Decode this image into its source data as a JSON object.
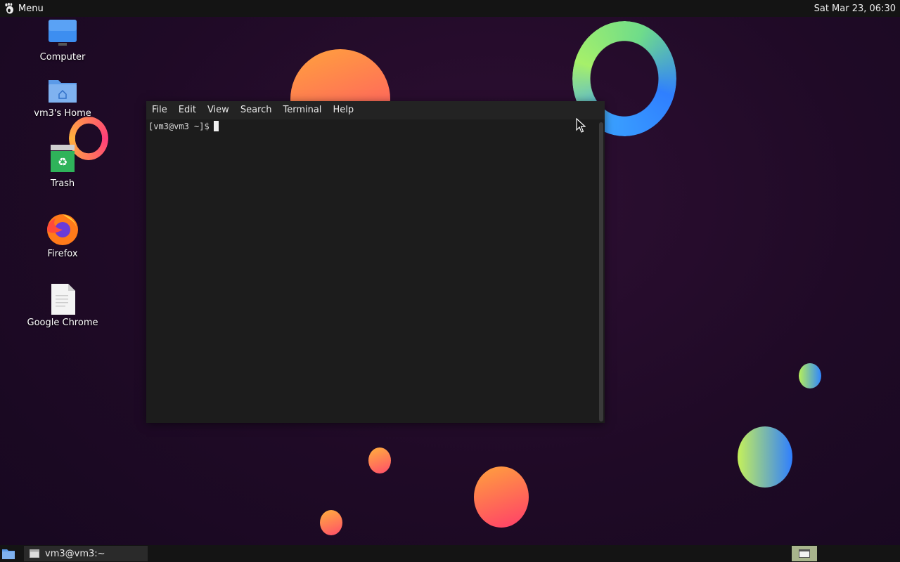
{
  "top_panel": {
    "menu_label": "Menu",
    "clock": "Sat Mar 23, 06:30"
  },
  "desktop": {
    "icons": [
      {
        "label": "Computer",
        "icon": "computer-icon"
      },
      {
        "label": "vm3's Home",
        "icon": "home-folder-icon"
      },
      {
        "label": "Trash",
        "icon": "trash-icon"
      },
      {
        "label": "Firefox",
        "icon": "firefox-icon"
      },
      {
        "label": "Google Chrome",
        "icon": "file-icon"
      }
    ]
  },
  "terminal": {
    "menu": [
      "File",
      "Edit",
      "View",
      "Search",
      "Terminal",
      "Help"
    ],
    "prompt": "[vm3@vm3 ~]$"
  },
  "bottom_panel": {
    "task_label": "vm3@vm3:~"
  },
  "colors": {
    "panel": "#141414",
    "terminal_bg": "#1c1c1c",
    "workspace_active": "#a8b48c"
  }
}
